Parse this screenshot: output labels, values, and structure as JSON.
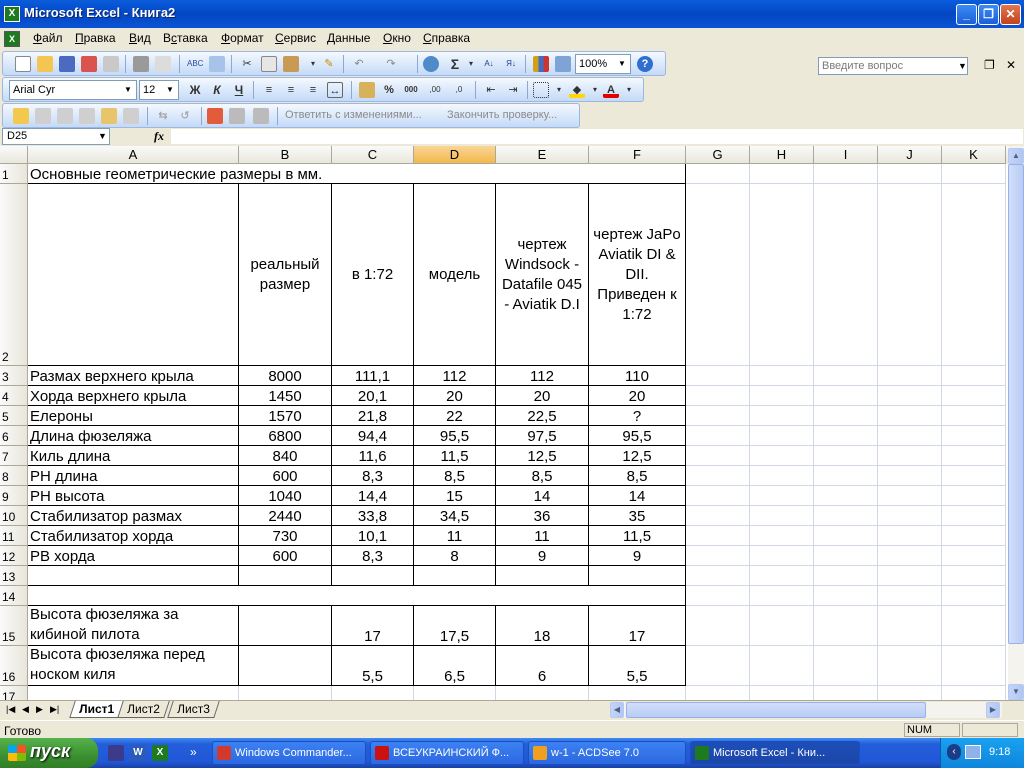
{
  "window": {
    "title": "Microsoft Excel - Книга2",
    "minimize": "_",
    "restore": "❐",
    "close": "✕"
  },
  "menu": [
    "Файл",
    "Правка",
    "Вид",
    "Вставка",
    "Формат",
    "Сервис",
    "Данные",
    "Окно",
    "Справка"
  ],
  "menu_underline": [
    "Ф",
    "П",
    "В",
    "с",
    "Ф",
    "С",
    "Д",
    "О",
    "С"
  ],
  "ask_placeholder": "Введите вопрос",
  "doc_controls": [
    "▾",
    "❐",
    "✕"
  ],
  "toolbar": {
    "zoom": "100%",
    "font_name": "Arial Cyr",
    "font_size": "12",
    "bold": "Ж",
    "italic": "К",
    "underline": "Ч",
    "sigma": "Σ",
    "percent": "%",
    "thousands": "000",
    "reply_changes": "Ответить с изменениями...",
    "end_review": "Закончить проверку..."
  },
  "formula": {
    "namebox": "D25",
    "fx": "fx",
    "value": ""
  },
  "columns": [
    "A",
    "B",
    "C",
    "D",
    "E",
    "F",
    "G",
    "H",
    "I",
    "J",
    "K"
  ],
  "selected_column": "D",
  "rows": [
    {
      "n": "1",
      "cells": [
        "Основные геометрические размеры в мм.",
        "",
        "",
        "",
        "",
        ""
      ]
    },
    {
      "n": "2",
      "cells": [
        "",
        "реальный размер",
        "в 1:72",
        "модель",
        "чертеж Windsock - Datafile 045 - Aviatik D.I",
        "чертеж JaPo Aviatik DI & DII. Приведен к 1:72"
      ]
    },
    {
      "n": "3",
      "cells": [
        "Размах верхнего крыла",
        "8000",
        "111,1",
        "112",
        "112",
        "110"
      ]
    },
    {
      "n": "4",
      "cells": [
        "Хорда верхнего крыла",
        "1450",
        "20,1",
        "20",
        "20",
        "20"
      ]
    },
    {
      "n": "5",
      "cells": [
        "Елероны",
        "1570",
        "21,8",
        "22",
        "22,5",
        "?"
      ]
    },
    {
      "n": "6",
      "cells": [
        "Длина фюзеляжа",
        "6800",
        "94,4",
        "95,5",
        "97,5",
        "95,5"
      ]
    },
    {
      "n": "7",
      "cells": [
        "Киль длина",
        "840",
        "11,6",
        "11,5",
        "12,5",
        "12,5"
      ]
    },
    {
      "n": "8",
      "cells": [
        "РН длина",
        "600",
        "8,3",
        "8,5",
        "8,5",
        "8,5"
      ]
    },
    {
      "n": "9",
      "cells": [
        "РН высота",
        "1040",
        "14,4",
        "15",
        "14",
        "14"
      ]
    },
    {
      "n": "10",
      "cells": [
        "Стабилизатор размах",
        "2440",
        "33,8",
        "34,5",
        "36",
        "35"
      ]
    },
    {
      "n": "11",
      "cells": [
        "Стабилизатор хорда",
        "730",
        "10,1",
        "11",
        "11",
        "11,5"
      ]
    },
    {
      "n": "12",
      "cells": [
        "РВ хорда",
        "600",
        "8,3",
        "8",
        "9",
        "9"
      ]
    },
    {
      "n": "13",
      "cells": [
        "",
        "",
        "",
        "",
        "",
        ""
      ]
    },
    {
      "n": "14",
      "cells": [
        "",
        "",
        "",
        "",
        "",
        ""
      ]
    },
    {
      "n": "15",
      "cells": [
        "Высота фюзеляжа за кибиной пилота",
        "",
        "17",
        "17,5",
        "18",
        "17"
      ]
    },
    {
      "n": "16",
      "cells": [
        "Высота фюзеляжа перед носком киля",
        "",
        "5,5",
        "6,5",
        "6",
        "5,5"
      ]
    },
    {
      "n": "17",
      "cells": [
        "",
        "",
        "",
        "",
        "",
        ""
      ]
    }
  ],
  "sheets": [
    "Лист1",
    "Лист2",
    "Лист3"
  ],
  "active_sheet": "Лист1",
  "status": {
    "text": "Готово",
    "num": "NUM"
  },
  "taskbar": {
    "start": "пуск",
    "tasks": [
      {
        "label": "Windows Commander...",
        "color": "#d23a2e"
      },
      {
        "label": "ВСЕУКРАИНСКИЙ Ф...",
        "color": "#cc1111"
      },
      {
        "label": "w-1 - ACDSee 7.0",
        "color": "#f0a020"
      },
      {
        "label": "Microsoft Excel - Кни...",
        "color": "#1e7a1e"
      }
    ],
    "active_task": 3,
    "clock": "9:18",
    "quick_more": "»"
  }
}
